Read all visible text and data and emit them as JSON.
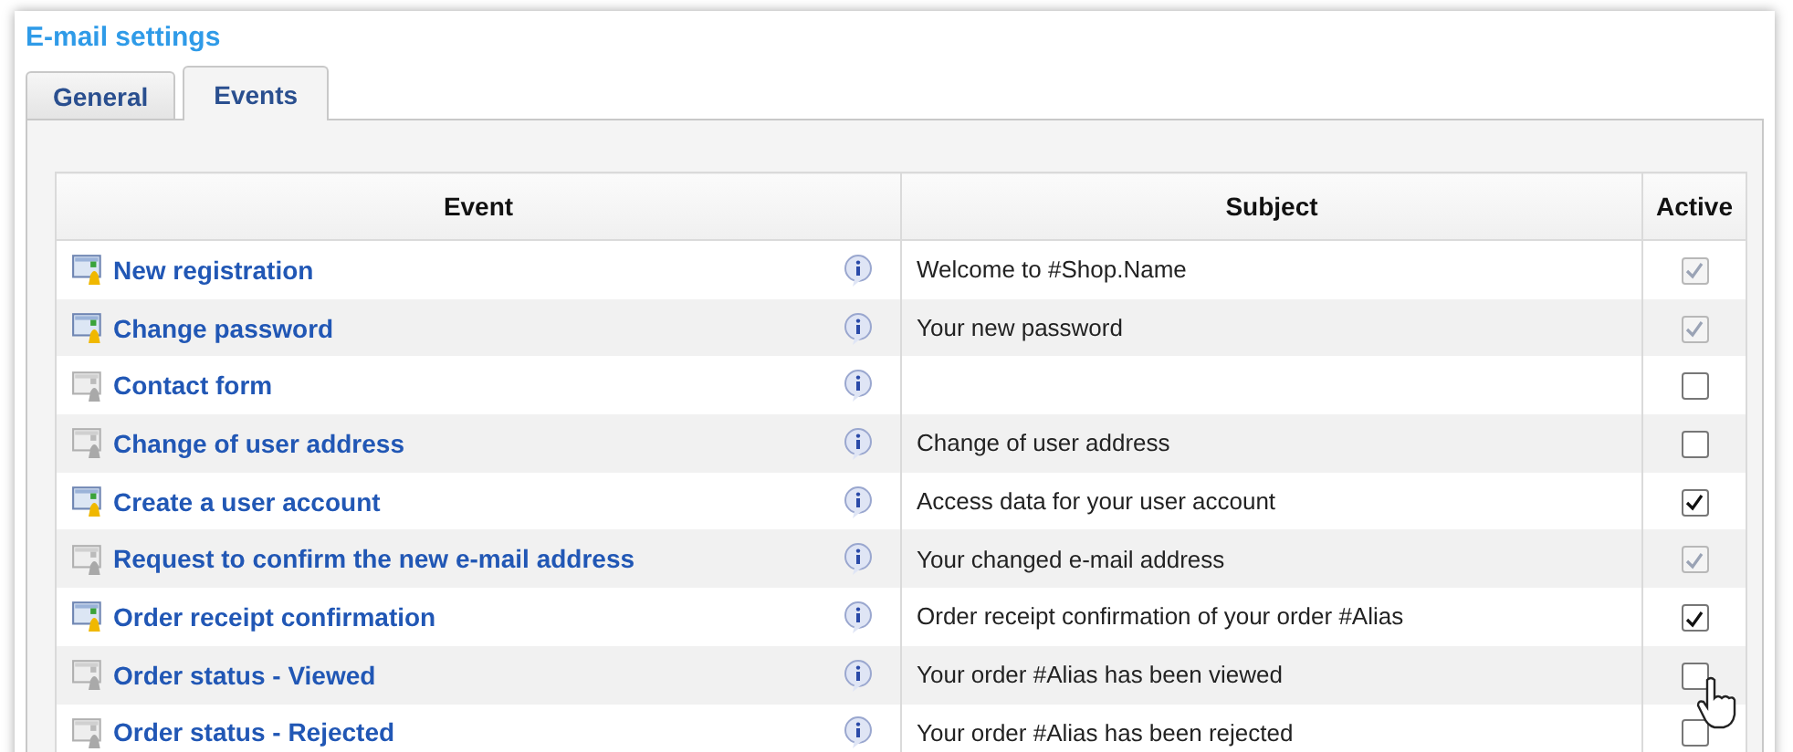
{
  "title": "E-mail settings",
  "tabs": [
    {
      "label": "General",
      "selected": false
    },
    {
      "label": "Events",
      "selected": true
    }
  ],
  "table": {
    "columns": [
      "Event",
      "Subject",
      "Active"
    ],
    "rows": [
      {
        "event": "New registration",
        "customized": true,
        "subject": "Welcome to #Shop.Name",
        "active": true,
        "disabled": true
      },
      {
        "event": "Change password",
        "customized": true,
        "subject": "Your new password",
        "active": true,
        "disabled": true
      },
      {
        "event": "Contact form",
        "customized": false,
        "active": false,
        "disabled": false
      },
      {
        "event": "Change of user address",
        "customized": false,
        "subject": "Change of user address",
        "active": false,
        "disabled": false
      },
      {
        "event": "Create a user account",
        "customized": true,
        "subject": "Access data for your user account",
        "active": true,
        "disabled": false
      },
      {
        "event": "Request to confirm the new e-mail address",
        "customized": false,
        "subject": "Your changed e-mail address",
        "active": true,
        "disabled": true
      },
      {
        "event": "Order receipt confirmation",
        "customized": true,
        "subject": "Order receipt confirmation of your order #Alias",
        "active": true,
        "disabled": false
      },
      {
        "event": "Order status - Viewed",
        "customized": false,
        "subject": "Your order #Alias has been viewed",
        "active": false,
        "disabled": false
      },
      {
        "event": "Order status - Rejected",
        "customized": false,
        "subject": "Your order #Alias has been rejected",
        "active": false,
        "disabled": false
      }
    ]
  }
}
